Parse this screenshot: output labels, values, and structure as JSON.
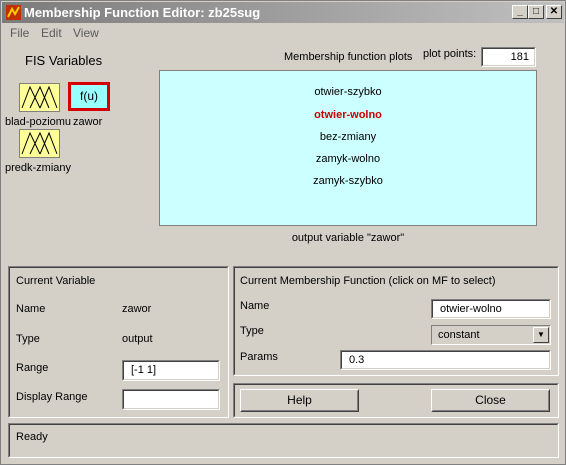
{
  "window": {
    "title": "Membership Function Editor: zb25sug",
    "minimize_glyph": "_",
    "maximize_glyph": "□",
    "close_glyph": "✕"
  },
  "menu": {
    "file": "File",
    "edit": "Edit",
    "view": "View"
  },
  "fis_variables": {
    "heading": "FIS Variables",
    "input1_label": "blad-poziomu",
    "input2_label": "predk-zmiany",
    "output_label": "zawor",
    "output_box_text": "f(u)"
  },
  "plot": {
    "title": "Membership function plots",
    "plot_points_label": "plot points:",
    "plot_points_value": "181",
    "mf_items": [
      "otwier-szybko",
      "otwier-wolno",
      "bez-zmiany",
      "zamyk-wolno",
      "zamyk-szybko"
    ],
    "selected_index": 1,
    "caption": "output variable \"zawor\""
  },
  "current_variable": {
    "heading": "Current Variable",
    "name_label": "Name",
    "name_value": "zawor",
    "type_label": "Type",
    "type_value": "output",
    "range_label": "Range",
    "range_value": "[-1 1]",
    "display_range_label": "Display Range",
    "display_range_value": ""
  },
  "current_mf": {
    "heading": "Current Membership Function (click on MF to select)",
    "name_label": "Name",
    "name_value": "otwier-wolno",
    "type_label": "Type",
    "type_value": "constant",
    "params_label": "Params",
    "params_value": "0.3"
  },
  "buttons": {
    "help": "Help",
    "close": "Close"
  },
  "status": {
    "text": "Ready"
  },
  "colors": {
    "input_box": "#ffff99",
    "output_box": "#99ffff",
    "selection": "#d40000",
    "selected_mf": "#cc0000",
    "plot_bg": "#ccffff"
  }
}
